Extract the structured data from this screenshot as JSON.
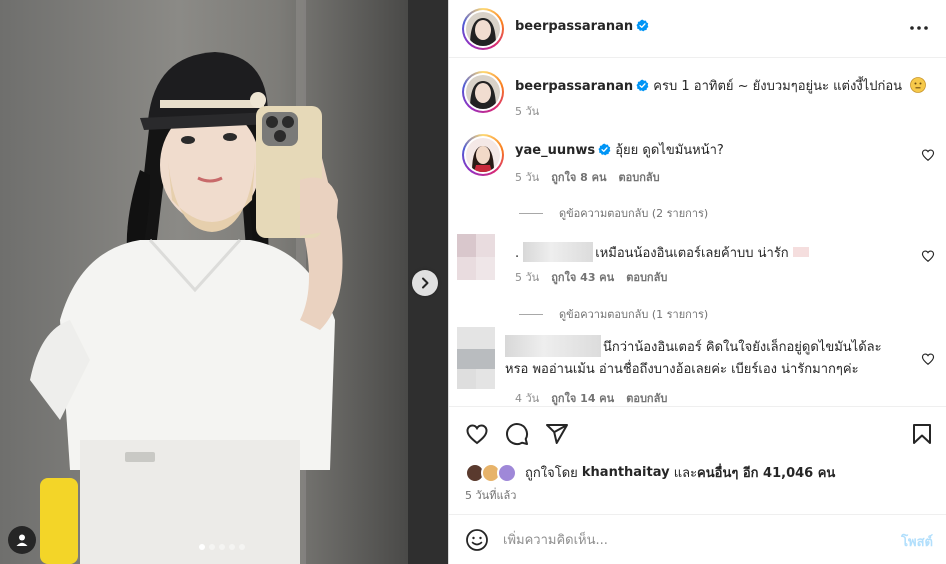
{
  "post": {
    "author": "beerpassaranan",
    "caption": "ครบ 1 อาทิตย์ ~ ยังบวมๆอยู่นะ แต่งงี้ไปก่อน",
    "caption_time": "5 วัน",
    "carousel": {
      "total": 5,
      "active": 1
    }
  },
  "comments": [
    {
      "username": "yae_uunws",
      "verified": true,
      "text": "อุ้ยย ดูดไขมันหน้า?",
      "time": "5 วัน",
      "likes": "ถูกใจ 8 คน",
      "reply": "ตอบกลับ",
      "view_replies": "ดูข้อความตอบกลับ (2 รายการ)"
    },
    {
      "prefix": ".",
      "text": "เหมือนน้องอินเตอร์เลยค้าบบ น่ารัก",
      "time": "5 วัน",
      "likes": "ถูกใจ 43 คน",
      "reply": "ตอบกลับ",
      "view_replies": "ดูข้อความตอบกลับ (1 รายการ)"
    },
    {
      "text_line1": "นึกว่าน้องอินเตอร์ คิดในใจยังเล็กอยู่ดูดไขมันได้ละ",
      "text_line2": "หรอ พออ่านเม้น อ่านชื่อถึงบางอ้อเลยค่ะ เบียร์เอง น่ารักมากๆค่ะ",
      "time": "4 วัน",
      "likes": "ถูกใจ 14 คน",
      "reply": "ตอบกลับ"
    }
  ],
  "likes_summary": {
    "prefix": "ถูกใจโดย",
    "user": "khanthaitay",
    "joiner": "และ",
    "others": "คนอื่นๆ อีก 41,046 คน"
  },
  "posted_time": "5 วันที่แล้ว",
  "comment_input": {
    "placeholder": "เพิ่มความคิดเห็น...",
    "post_label": "โพสต์"
  },
  "icons": {
    "verified": "verified-badge-icon",
    "more": "more-options-icon",
    "like": "heart-icon",
    "comment": "comment-icon",
    "share": "share-icon",
    "save": "bookmark-icon",
    "emoji": "emoji-icon",
    "next": "chevron-right-icon",
    "tags": "user-tag-icon"
  },
  "colors": {
    "accent": "#0095f6",
    "verified": "#0095f6",
    "post_button": "#b2dffc",
    "meta_text": "#8e8e8e"
  }
}
